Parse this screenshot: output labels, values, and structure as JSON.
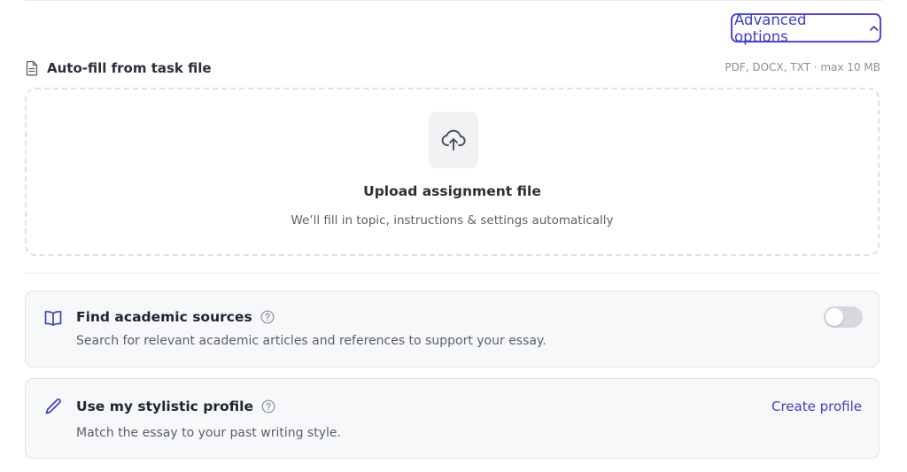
{
  "advanced_options": {
    "label": "Advanced options"
  },
  "autofill": {
    "title": "Auto-fill from task file",
    "file_hint": "PDF, DOCX, TXT · max 10 MB"
  },
  "dropzone": {
    "title": "Upload assignment file",
    "subtitle": "We’ll fill in topic, instructions & settings automatically"
  },
  "academic_sources": {
    "title": "Find academic sources",
    "description": "Search for relevant academic articles and references to support your essay.",
    "enabled": false
  },
  "stylistic_profile": {
    "title": "Use my stylistic profile",
    "description": "Match the essay to your past writing style.",
    "action_label": "Create profile"
  },
  "colors": {
    "accent": "#4f46e5",
    "card_bg": "#f7f8fa",
    "toggle_off": "#d6d8dd"
  }
}
